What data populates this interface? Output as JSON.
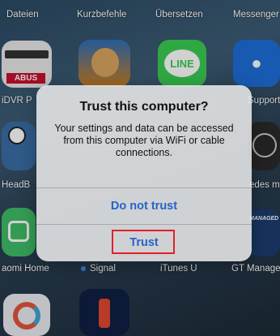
{
  "top_row_labels": [
    "Dateien",
    "Kurzbefehle",
    "Übersetzen",
    "Messenger"
  ],
  "row2": {
    "abus_badge": "ABUS",
    "line_icon_text": "LINE",
    "left_label": "iDVR P",
    "right_label": "Support"
  },
  "row3": {
    "left_label": "HeadB",
    "right_label": "edes m"
  },
  "row4": {
    "managed_badge": "MANAGED",
    "labels": [
      "aomi Home",
      "Signal",
      "iTunes U",
      "GT Manage"
    ]
  },
  "alert": {
    "title": "Trust this computer?",
    "message": "Your settings and data can be accessed from this computer via WiFi or cable connections.",
    "buttons": {
      "do_not_trust": "Do not trust",
      "trust": "Trust"
    },
    "highlight_color": "#e0202b",
    "button_color": "#2463c9"
  }
}
